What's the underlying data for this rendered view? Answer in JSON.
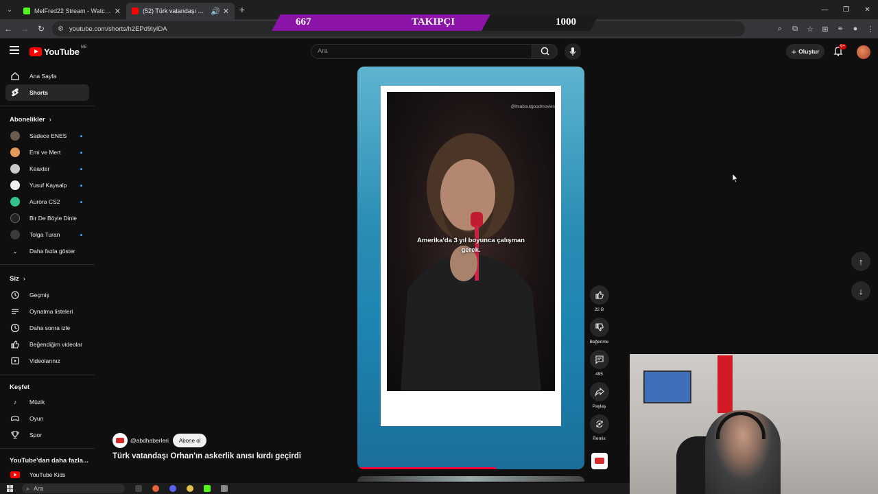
{
  "browser": {
    "tabs": [
      {
        "title": "MelFred22 Stream - Watch Live",
        "favicon_color": "#53fc18",
        "active": false
      },
      {
        "title": "(52) Türk vatandaşı Orhan'ın",
        "favicon_color": "#ff0000",
        "active": true
      }
    ],
    "url": "youtube.com/shorts/h2EPd9IyIDA"
  },
  "follower_overlay": {
    "current": "667",
    "label": "TAKIPÇI",
    "goal": "1000",
    "progress_fraction": 0.667,
    "fill_color": "#8b13a8"
  },
  "header": {
    "logo_text": "YouTube",
    "region": "ME",
    "search_placeholder": "Ara",
    "create_label": "Oluştur",
    "notification_count": "9+"
  },
  "sidebar": {
    "main": [
      {
        "label": "Ana Sayfa",
        "icon": "home-icon",
        "active": false
      },
      {
        "label": "Shorts",
        "icon": "shorts-icon",
        "active": true
      }
    ],
    "subscriptions_heading": "Abonelikler",
    "subscriptions": [
      {
        "label": "Sadece ENES",
        "avatar_color": "#6b5a4e"
      },
      {
        "label": "Emi ve Mert",
        "avatar_color": "#e59a58"
      },
      {
        "label": "Keaxter",
        "avatar_color": "#c9c9c9"
      },
      {
        "label": "Yusuf Kayaalp",
        "avatar_color": "#eeeeee"
      },
      {
        "label": "Aurora CS2",
        "avatar_color": "#33c18b"
      },
      {
        "label": "Bir De Böyle Dinle",
        "avatar_color": "#222222"
      },
      {
        "label": "Tolga Turan",
        "avatar_color": "#3b3b3b"
      }
    ],
    "show_more_label": "Daha fazla göster",
    "you_heading": "Siz",
    "you_items": [
      {
        "label": "Geçmiş",
        "icon": "history-icon"
      },
      {
        "label": "Oynatma listeleri",
        "icon": "playlist-icon"
      },
      {
        "label": "Daha sonra izle",
        "icon": "watch-later-icon"
      },
      {
        "label": "Beğendiğim videolar",
        "icon": "liked-icon"
      },
      {
        "label": "Videolarınız",
        "icon": "your-videos-icon"
      }
    ],
    "explore_heading": "Keşfet",
    "explore_items": [
      {
        "label": "Müzik",
        "icon": "music-icon"
      },
      {
        "label": "Oyun",
        "icon": "gaming-icon"
      },
      {
        "label": "Spor",
        "icon": "trophy-icon"
      }
    ],
    "more_heading": "YouTube'dan daha fazla...",
    "kids_label": "YouTube Kids"
  },
  "short": {
    "watermark": "@itsaboutgoodmovies",
    "subtitle_line1": "Amerika'da 3 yıl boyunca çalışman",
    "subtitle_line2": "gerek.",
    "channel_handle": "@abdhaberleri",
    "subscribe_label": "Abone ol",
    "title": "Türk vatandaşı Orhan'ın askerlik anısı kırdı geçirdi",
    "progress_fraction": 0.61
  },
  "actions": {
    "likes": "22 B",
    "dislike_label": "Beğenme",
    "comments": "495",
    "share_label": "Paylaş",
    "remix_label": "Remix"
  },
  "taskbar": {
    "search_placeholder": "Ara"
  }
}
